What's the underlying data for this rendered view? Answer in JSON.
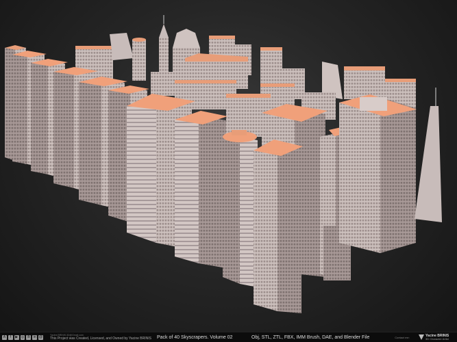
{
  "footer": {
    "social_icons": [
      "artstation-icon",
      "facebook-icon",
      "youtube-icon",
      "instagram-icon",
      "behance-icon",
      "linkedin-icon",
      "email-icon"
    ],
    "email_line": "Yacine.BRINIS.3D@Gmail.com",
    "license": "This Project was Created, Licensed, and Owned by Yacine BRINIS",
    "title": "Pack of 40 Skyscrapers. Volume 02",
    "formats": "Obj, STL, ZTL, FBX, IMM Brush, DAE, and Blender File",
    "contact": "Contact me:",
    "brand_name": "Yacine BRINIS",
    "brand_sub": "3D Character Artist"
  },
  "colors": {
    "roof": "#f0a07a",
    "wall": "#cfc3c0",
    "wall_shade": "#a89896",
    "background": "#2a2a2a"
  }
}
